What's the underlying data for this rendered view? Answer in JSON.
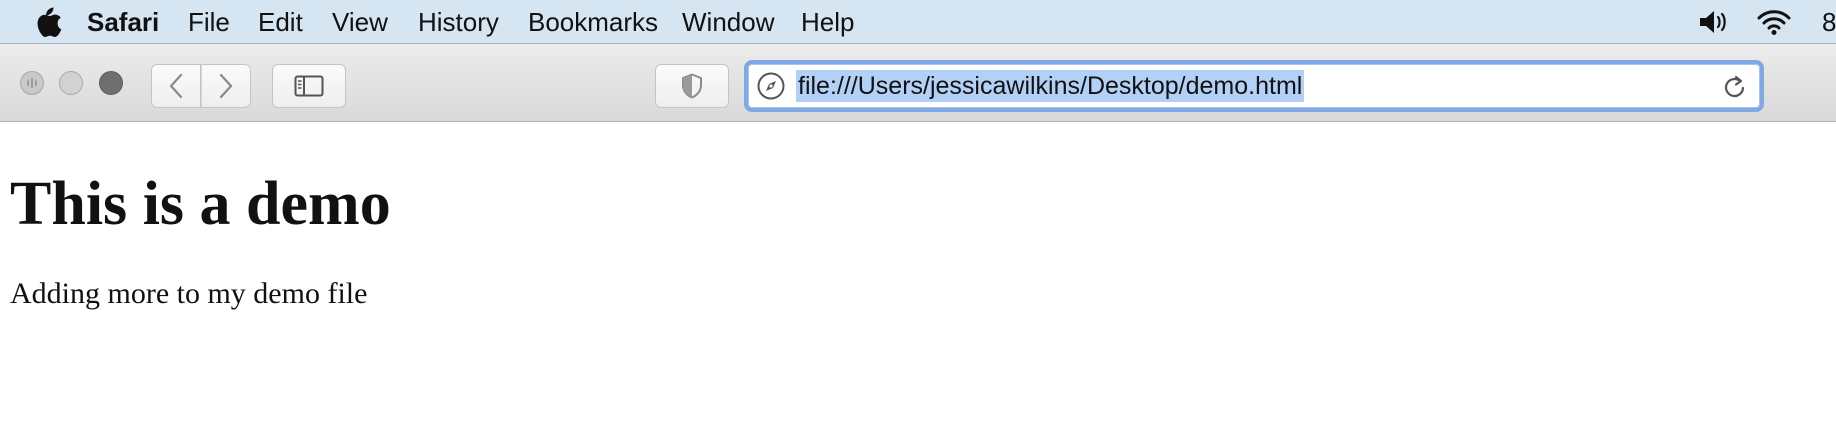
{
  "menubar": {
    "app_name": "Safari",
    "items": [
      "File",
      "Edit",
      "View",
      "History",
      "Bookmarks",
      "Window",
      "Help"
    ],
    "clock_fragment": "8",
    "icons": [
      "apple-logo",
      "volume-icon",
      "wifi-icon"
    ]
  },
  "toolbar": {
    "icons": [
      "back-chevron-icon",
      "forward-chevron-icon",
      "sidebar-icon",
      "shield-icon",
      "compass-icon",
      "reload-icon"
    ],
    "address": {
      "url": "file:///Users/jessicawilkins/Desktop/demo.html",
      "selected": true,
      "focus_color": "#7fa8e4",
      "selection_color": "#b3d1f6"
    }
  },
  "page": {
    "heading": "This is a demo",
    "paragraph": "Adding more to my demo file"
  }
}
